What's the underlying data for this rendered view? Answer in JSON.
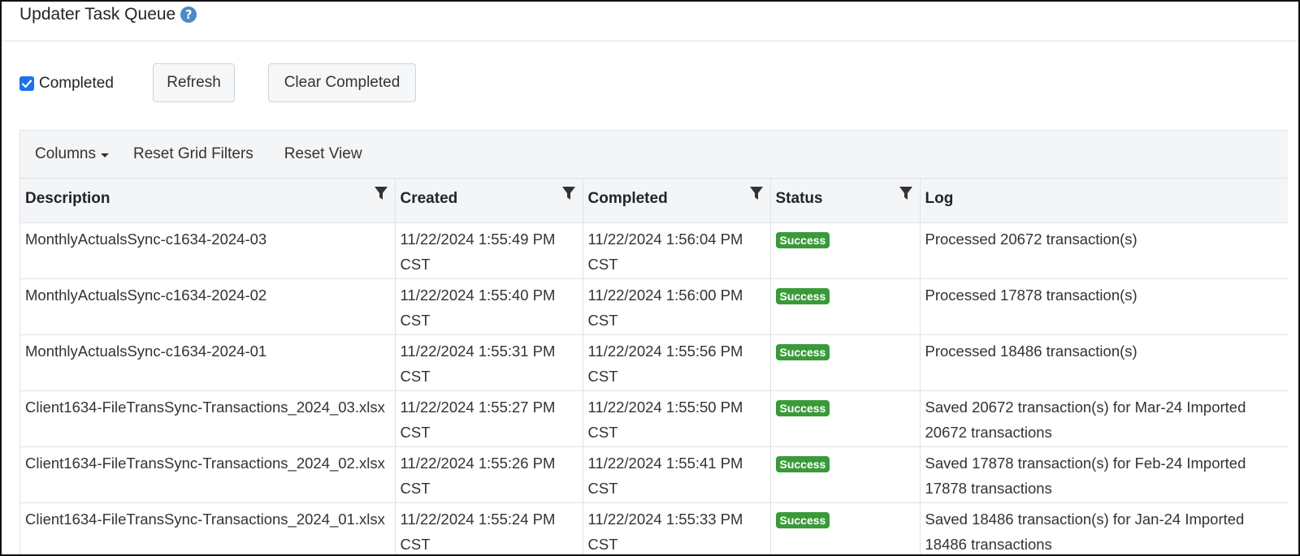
{
  "header": {
    "title": "Updater Task Queue"
  },
  "toolbar": {
    "completed_label": "Completed",
    "completed_checked": true,
    "refresh_label": "Refresh",
    "clear_completed_label": "Clear Completed"
  },
  "grid_toolbar": {
    "columns_label": "Columns",
    "reset_filters_label": "Reset Grid Filters",
    "reset_view_label": "Reset View"
  },
  "table": {
    "columns": [
      "Description",
      "Created",
      "Completed",
      "Status",
      "Log"
    ],
    "rows": [
      {
        "description": "MonthlyActualsSync-c1634-2024-03",
        "created": "11/22/2024 1:55:49 PM CST",
        "completed": "11/22/2024 1:56:04 PM CST",
        "status": "Success",
        "log": "Processed 20672 transaction(s)"
      },
      {
        "description": "MonthlyActualsSync-c1634-2024-02",
        "created": "11/22/2024 1:55:40 PM CST",
        "completed": "11/22/2024 1:56:00 PM CST",
        "status": "Success",
        "log": "Processed 17878 transaction(s)"
      },
      {
        "description": "MonthlyActualsSync-c1634-2024-01",
        "created": "11/22/2024 1:55:31 PM CST",
        "completed": "11/22/2024 1:55:56 PM CST",
        "status": "Success",
        "log": "Processed 18486 transaction(s)"
      },
      {
        "description": "Client1634-FileTransSync-Transactions_2024_03.xlsx",
        "created": "11/22/2024 1:55:27 PM CST",
        "completed": "11/22/2024 1:55:50 PM CST",
        "status": "Success",
        "log": "Saved 20672 transaction(s) for Mar-24 Imported 20672 transactions"
      },
      {
        "description": "Client1634-FileTransSync-Transactions_2024_02.xlsx",
        "created": "11/22/2024 1:55:26 PM CST",
        "completed": "11/22/2024 1:55:41 PM CST",
        "status": "Success",
        "log": "Saved 17878 transaction(s) for Feb-24 Imported 17878 transactions"
      },
      {
        "description": "Client1634-FileTransSync-Transactions_2024_01.xlsx",
        "created": "11/22/2024 1:55:24 PM CST",
        "completed": "11/22/2024 1:55:33 PM CST",
        "status": "Success",
        "log": "Saved 18486 transaction(s) for Jan-24 Imported 18486 transactions"
      }
    ]
  },
  "colors": {
    "success": "#3a9a3a",
    "help_icon": "#4a8bc9",
    "checkbox": "#1a73e8"
  },
  "icons": {
    "help": "question-circle-icon",
    "filter": "filter-icon",
    "check": "checkmark-icon",
    "caret": "caret-down-icon"
  }
}
